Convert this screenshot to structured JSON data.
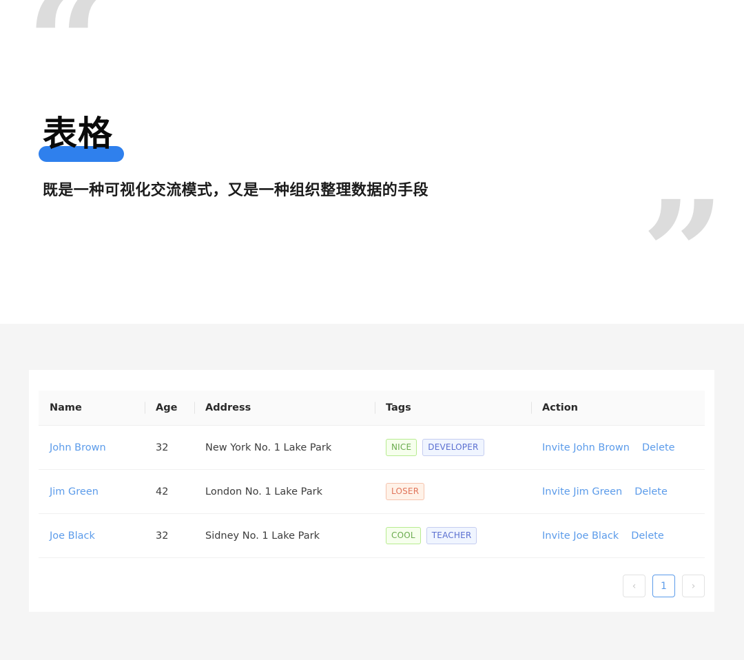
{
  "hero": {
    "open_quote": "“",
    "close_quote": "”",
    "title": "表格",
    "subtitle": "既是一种可视化交流模式，又是一种组织整理数据的手段",
    "accent_color": "#2f80ed",
    "quote_color": "#dcdcdc"
  },
  "table": {
    "columns": [
      {
        "key": "name",
        "label": "Name"
      },
      {
        "key": "age",
        "label": "Age"
      },
      {
        "key": "address",
        "label": "Address"
      },
      {
        "key": "tags",
        "label": "Tags"
      },
      {
        "key": "action",
        "label": "Action"
      }
    ],
    "rows": [
      {
        "name": "John Brown",
        "age": "32",
        "address": "New York No. 1 Lake Park",
        "tags": [
          {
            "label": "NICE",
            "color": "green"
          },
          {
            "label": "DEVELOPER",
            "color": "blue"
          }
        ],
        "invite": "Invite John Brown",
        "delete": "Delete"
      },
      {
        "name": "Jim Green",
        "age": "42",
        "address": "London No. 1 Lake Park",
        "tags": [
          {
            "label": "LOSER",
            "color": "volcano"
          }
        ],
        "invite": "Invite Jim Green",
        "delete": "Delete"
      },
      {
        "name": "Joe Black",
        "age": "32",
        "address": "Sidney No. 1 Lake Park",
        "tags": [
          {
            "label": "COOL",
            "color": "green"
          },
          {
            "label": "TEACHER",
            "color": "blue"
          }
        ],
        "invite": "Invite Joe Black",
        "delete": "Delete"
      }
    ],
    "link_color": "#5b9bea",
    "tag_colors": {
      "green": "#6aab4e",
      "blue": "#5a6fd0",
      "volcano": "#e0745a"
    }
  },
  "pagination": {
    "prev_label": "‹",
    "next_label": "›",
    "pages": [
      {
        "label": "1",
        "active": true
      }
    ],
    "current_page": "1",
    "active_color": "#5b9bea"
  }
}
